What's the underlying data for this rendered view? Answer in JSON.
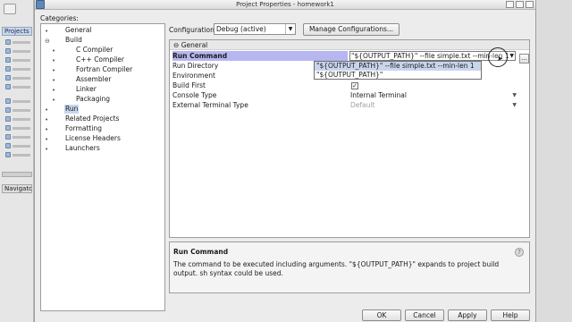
{
  "ide": {
    "projects_tab": "Projects",
    "navigator_tab": "Navigator"
  },
  "dialog": {
    "title": "Project Properties - homework1",
    "categories_label": "Categories:",
    "categories": [
      {
        "label": "General"
      },
      {
        "label": "Build"
      },
      {
        "label": "C Compiler"
      },
      {
        "label": "C++ Compiler"
      },
      {
        "label": "Fortran Compiler"
      },
      {
        "label": "Assembler"
      },
      {
        "label": "Linker"
      },
      {
        "label": "Packaging"
      },
      {
        "label": "Run",
        "selected": true
      },
      {
        "label": "Related Projects"
      },
      {
        "label": "Formatting"
      },
      {
        "label": "License Headers"
      },
      {
        "label": "Launchers"
      }
    ],
    "configuration_label": "Configuration:",
    "configuration_value": "Debug (active)",
    "manage_button": "Manage Configurations...",
    "properties": {
      "section_title": "General",
      "rows": [
        {
          "name": "Run Command",
          "value": "\"${OUTPUT_PATH}\" --file simple.txt --min-len 1",
          "selected": true
        },
        {
          "name": "Run Directory",
          "value": ""
        },
        {
          "name": "Environment",
          "value": ""
        },
        {
          "name": "Build First",
          "value": "checked"
        },
        {
          "name": "Console Type",
          "value": "Internal Terminal"
        },
        {
          "name": "External Terminal Type",
          "value": "Default",
          "disabled": true
        }
      ],
      "dropdown_options": [
        "\"${OUTPUT_PATH}\" --file simple.txt --min-len 1",
        "\"${OUTPUT_PATH}\""
      ],
      "ellipsis": "..."
    },
    "description": {
      "title": "Run Command",
      "text": "The command to be executed including arguments. \"${OUTPUT_PATH}\" expands to project build output. sh syntax could be used."
    },
    "buttons": {
      "ok": "OK",
      "cancel": "Cancel",
      "apply": "Apply",
      "help": "Help"
    }
  }
}
